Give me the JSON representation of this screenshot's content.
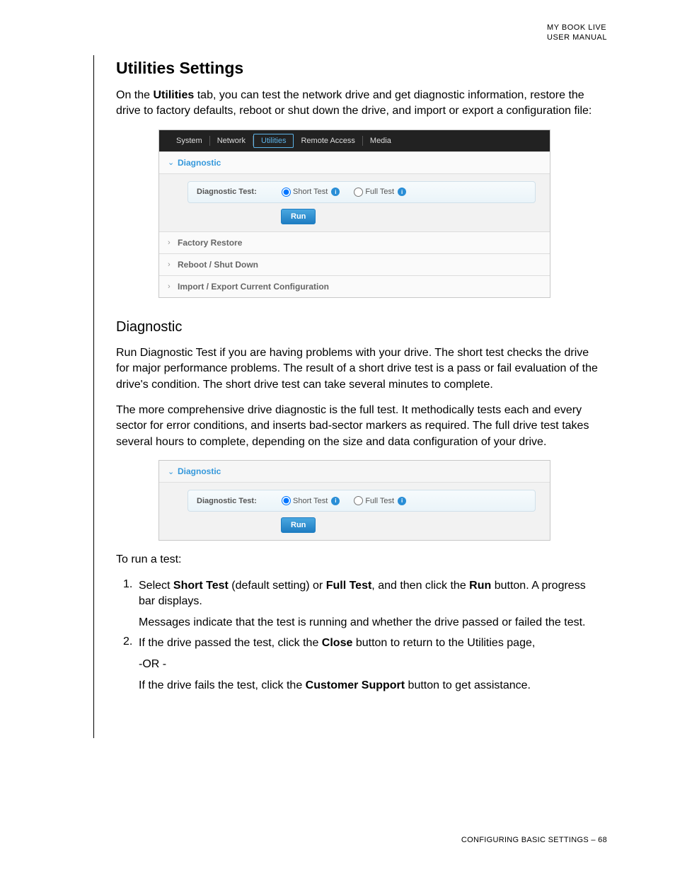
{
  "header": {
    "line1": "MY BOOK LIVE",
    "line2": "USER MANUAL"
  },
  "title": "Utilities Settings",
  "intro": {
    "prefix": "On the ",
    "bold1": "Utilities",
    "rest": " tab, you can test the network drive and get diagnostic information, restore the drive to factory defaults, reboot or shut down the drive, and import or export a configuration file:"
  },
  "shot1": {
    "tabs": [
      "System",
      "Network",
      "Utilities",
      "Remote Access",
      "Media"
    ],
    "activeTab": "Utilities",
    "sections": {
      "diagnostic": "Diagnostic",
      "factory": "Factory Restore",
      "reboot": "Reboot / Shut Down",
      "import": "Import / Export Current Configuration"
    },
    "diagLabel": "Diagnostic Test:",
    "shortTest": "Short Test",
    "fullTest": "Full Test",
    "run": "Run"
  },
  "h2_diag": "Diagnostic",
  "p_diag1": "Run Diagnostic Test if you are having problems with your drive. The short test checks the drive for major performance problems. The result of a short drive test is a pass or fail evaluation of the drive's condition. The short drive test can take several minutes to complete.",
  "p_diag2": "The more comprehensive drive diagnostic is the full test. It methodically tests each and every sector for error conditions, and inserts bad-sector markers as required. The full drive test takes several hours to complete, depending on the size and data configuration of your drive.",
  "to_run": "To run a test:",
  "step1": {
    "pre": "Select ",
    "b1": "Short Test",
    "mid1": " (default setting) or ",
    "b2": "Full Test",
    "mid2": ", and then click the ",
    "b3": "Run",
    "post": " button. A progress bar displays.",
    "sub": "Messages indicate that the test is running and whether the drive passed or failed the test."
  },
  "step2": {
    "pre": " If the drive passed the test, click the ",
    "b1": "Close",
    "mid1": " button to return to the Utilities page,",
    "or": "-OR -",
    "sub_pre": "If the drive fails the test, click the ",
    "b2": "Customer Support",
    "sub_post": " button to get assistance."
  },
  "footer": {
    "text": "CONFIGURING BASIC SETTINGS – ",
    "page": "68"
  }
}
